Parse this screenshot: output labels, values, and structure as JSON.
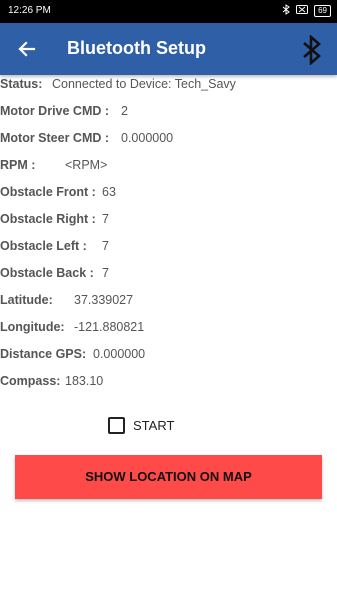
{
  "status_bar": {
    "time": "12:26 PM",
    "icons": [
      "bluetooth-icon",
      "sim-icon",
      "battery-icon"
    ],
    "battery": "69"
  },
  "appbar": {
    "title": "Bluetooth Setup",
    "back_icon": "arrow-left-icon",
    "action_icon": "bluetooth-icon",
    "color": "#2f5fa6"
  },
  "fields": {
    "status": {
      "label": "Status:",
      "value": "Connected to Device: Tech_Savy"
    },
    "motor_drive": {
      "label": "Motor Drive CMD :",
      "value": "2"
    },
    "motor_steer": {
      "label": "Motor Steer CMD :",
      "value": "0.000000"
    },
    "rpm": {
      "label": "RPM :",
      "value": "<RPM>"
    },
    "obstacle_front": {
      "label": "Obstacle Front :",
      "value": "63"
    },
    "obstacle_right": {
      "label": "Obstacle Right :",
      "value": "7"
    },
    "obstacle_left": {
      "label": "Obstacle Left :",
      "value": "7"
    },
    "obstacle_back": {
      "label": "Obstacle Back :",
      "value": "7"
    },
    "latitude": {
      "label": "Latitude:",
      "value": "37.339027"
    },
    "longitude": {
      "label": "Longitude:",
      "value": "-121.880821"
    },
    "distance_gps": {
      "label": "Distance GPS:",
      "value": "0.000000"
    },
    "compass": {
      "label": "Compass:",
      "value": "183.10"
    }
  },
  "start_checkbox": {
    "label": "START",
    "checked": false
  },
  "map_button": {
    "label": "SHOW LOCATION ON MAP",
    "color": "#ff4a4a"
  }
}
